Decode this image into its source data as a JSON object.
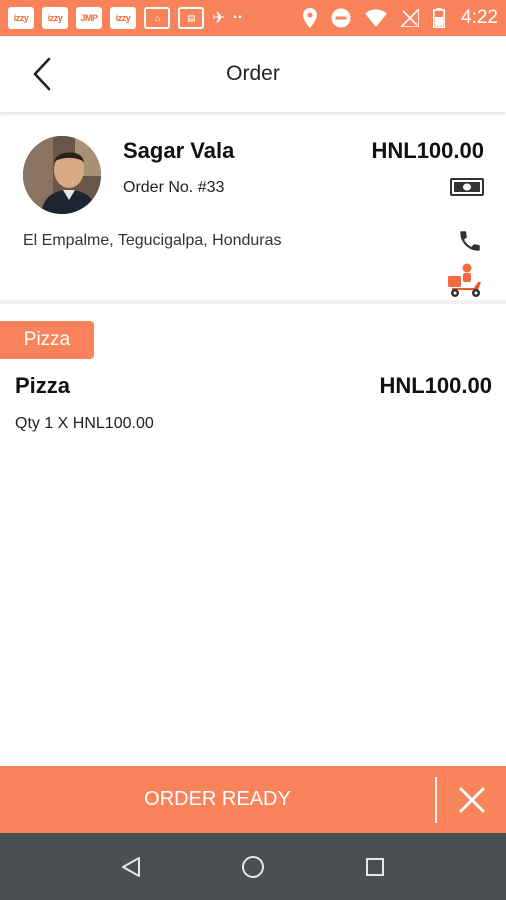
{
  "status_bar": {
    "notifications": [
      "izzy",
      "izzy",
      "JMP",
      "izzy"
    ],
    "time": "4:22",
    "icons": [
      "home-location-icon",
      "calendar-icon",
      "satellite-icon",
      "more-dots-icon",
      "location-pin-icon",
      "do-not-disturb-icon",
      "wifi-icon",
      "no-signal-icon",
      "battery-icon"
    ]
  },
  "header": {
    "title": "Order",
    "back_icon": "chevron-left-icon"
  },
  "customer": {
    "name": "Sagar Vala",
    "order_number": "Order No. #33",
    "total": "HNL100.00",
    "address": "El Empalme, Tegucigalpa, Honduras",
    "payment_icon": "cash-icon",
    "phone_icon": "phone-icon",
    "delivery_icon": "delivery-scooter-icon"
  },
  "order": {
    "categories": [
      {
        "label": "Pizza",
        "items": [
          {
            "name": "Pizza",
            "price": "HNL100.00",
            "qty_line": "Qty 1 X HNL100.00"
          }
        ]
      }
    ]
  },
  "actions": {
    "ready_label": "ORDER READY",
    "cancel_icon": "close-icon"
  },
  "nav_bar": {
    "icons": [
      "back-triangle-icon",
      "home-circle-icon",
      "recents-square-icon"
    ]
  },
  "colors": {
    "accent": "#f9845b",
    "nav_bar": "#4b4f53"
  }
}
